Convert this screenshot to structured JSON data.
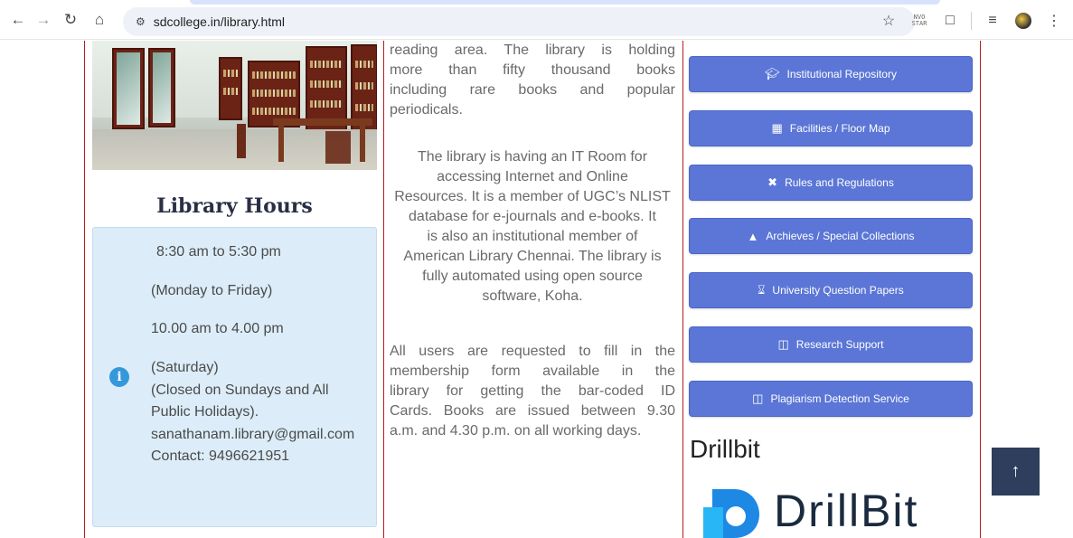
{
  "browser": {
    "url": "sdcollege.in/library.html",
    "nav_icons": [
      "back-arrow-icon",
      "forward-arrow-icon",
      "reload-icon",
      "home-icon",
      "site-settings-icon"
    ],
    "extension_badge": "NVO\nSTAR"
  },
  "left": {
    "hours_title": "Library Hours",
    "hours_lines": [
      "8:30 am to 5:30 pm",
      "(Monday to Friday)",
      "10.00 am to 4.00 pm",
      "(Saturday)",
      "(Closed on Sundays and All",
      "Public Holidays).",
      "sanathanam.library@gmail.com",
      "Contact: 9496621951"
    ]
  },
  "middle": {
    "p1_lines": [
      "reading area. The library is holding",
      "more than fifty thousand books",
      "including rare books and popular",
      "periodicals."
    ],
    "p2_lines": [
      "The library is having an IT Room for",
      "accessing Internet and Online",
      "Resources. It is a member of UGC’s NLIST",
      "database for e-journals and e-books. It",
      "is also an institutional member of",
      "American Library Chennai. The library is",
      "fully automated using  open source",
      "software, Koha."
    ],
    "p3_lines": [
      "All users are requested to fill in the",
      "membership form available in the",
      "library for getting the bar-coded ID",
      "Cards. Books are issued between 9.30",
      "a.m. and 4.30 p.m. on all working days."
    ]
  },
  "right": {
    "buttons": [
      {
        "label": "Institutional Repository",
        "icon": "graduation-cap-icon"
      },
      {
        "label": "Facilities / Floor Map",
        "icon": "building-icon"
      },
      {
        "label": "Rules and Regulations",
        "icon": "tools-icon"
      },
      {
        "label": "Archieves / Special Collections",
        "icon": "reading-person-icon"
      },
      {
        "label": "University Question Papers",
        "icon": "hourglass-icon"
      },
      {
        "label": "Research Support",
        "icon": "open-book-icon"
      },
      {
        "label": "Plagiarism Detection Service",
        "icon": "open-book-icon"
      }
    ],
    "drillbit_heading": "Drillbit",
    "drillbit_logo_text": "DrillBit"
  },
  "colors": {
    "accent_button": "#5b76d6",
    "frame_red": "#b71c1c",
    "hours_box_bg": "#dcedf9",
    "scroll_top_bg": "#2e3e5c"
  }
}
